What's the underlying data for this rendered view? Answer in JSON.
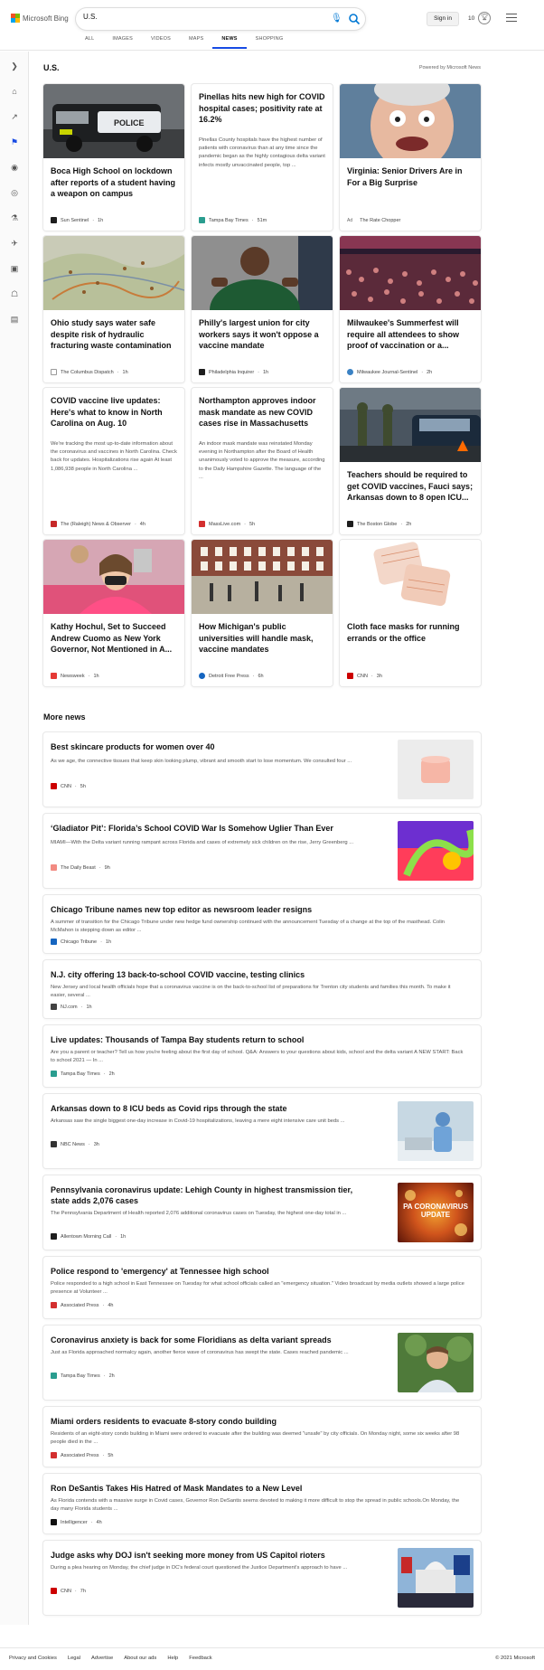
{
  "header": {
    "brand": "Microsoft Bing",
    "search_value": "U.S.",
    "sign_in": "Sign in",
    "rewards_count": "10",
    "tabs": [
      {
        "label": "ALL"
      },
      {
        "label": "IMAGES"
      },
      {
        "label": "VIDEOS"
      },
      {
        "label": "MAPS"
      },
      {
        "label": "NEWS"
      },
      {
        "label": "SHOPPING"
      }
    ],
    "active_tab": "NEWS",
    "accent": "#174ae4"
  },
  "rail": {
    "icons": [
      "expand-icon",
      "home-icon",
      "trending-icon",
      "flag-icon",
      "location-icon",
      "globe-icon",
      "science-icon",
      "rocket-icon",
      "video-icon",
      "building-icon",
      "grid-icon"
    ]
  },
  "section": {
    "title": "U.S.",
    "powered_by": "Powered by Microsoft News"
  },
  "cards": [
    {
      "headline": "Boca High School on lockdown after reports of a student having a weapon on campus",
      "source": "Sun Sentinel",
      "time": "1h",
      "image": "police-car",
      "fav": "#1e1e1e"
    },
    {
      "headline": "Pinellas hits new high for COVID hospital cases; positivity rate at 16.2%",
      "snippet": "Pinellas County hospitals have the highest number of patients with coronavirus than at any time since the pandemic began as the highly contagious delta variant infects mostly unvaccinated people, top ...",
      "source": "Tampa Bay Times",
      "time": "51m",
      "fav": "#2a9d8f"
    },
    {
      "headline": "Virginia: Senior Drivers Are in For a Big Surprise",
      "ad": "Ad",
      "source": "The Rate Chopper",
      "time": "",
      "image": "man-face",
      "fav": "#ffffff"
    },
    {
      "headline": "Ohio study says water safe despite risk of hydraulic fracturing waste contamination",
      "source": "The Columbus Dispatch",
      "time": "1h",
      "image": "map",
      "fav": "#ffffff"
    },
    {
      "headline": "Philly's largest union for city workers says it won't oppose a vaccine mandate",
      "source": "Philadelphia Inquirer",
      "time": "1h",
      "image": "man-green",
      "fav": "#1e1e1e"
    },
    {
      "headline": "Milwaukee's Summerfest will require all attendees to show proof of vaccination or a...",
      "source": "Milwaukee Journal-Sentinel",
      "time": "2h",
      "image": "crowd",
      "fav": "#3b82c4"
    },
    {
      "headline": "COVID vaccine live updates: Here's what to know in North Carolina on Aug. 10",
      "snippet": "We're tracking the most up-to-date information about the coronavirus and vaccines in North Carolina. Check back for updates. Hospitalizations rise again At least 1,086,938 people in North Carolina ...",
      "source": "The (Raleigh) News & Observer",
      "time": "4h",
      "fav": "#c62828"
    },
    {
      "headline": "Northampton approves indoor mask mandate as new COVID cases rise in Massachusetts",
      "snippet": "An indoor mask mandate was reinstated Monday evening in Northampton after the Board of Health unanimously voted to approve the measure, according to the Daily Hampshire Gazette. The language of the ...",
      "source": "MassLive.com",
      "time": "5h",
      "fav": "#d32f2f"
    },
    {
      "headline": "Teachers should be required to get COVID vaccines, Fauci says; Arkansas down to 8 open ICU...",
      "source": "The Boston Globe",
      "time": "2h",
      "image": "checkpoint",
      "fav": "#1e1e1e"
    },
    {
      "headline": "Kathy Hochul, Set to Succeed Andrew Cuomo as New York Governor, Not Mentioned in A...",
      "source": "Newsweek",
      "time": "1h",
      "image": "woman-mask",
      "fav": "#e53935"
    },
    {
      "headline": "How Michigan's public universities will handle mask, vaccine mandates",
      "source": "Detroit Free Press",
      "time": "6h",
      "image": "campus",
      "fav": "#1565c0"
    },
    {
      "headline": "Cloth face masks for running errands or the office",
      "source": "CNN",
      "time": "3h",
      "image": "masks",
      "fav": "#cc0000"
    }
  ],
  "more_news": {
    "title": "More news",
    "items": [
      {
        "headline": "Best skincare products for women over 40",
        "snippet": "As we age, the connective tissues that keep skin looking plump, vibrant and smooth start to lose momentum. We consulted four ...",
        "source": "CNN",
        "time": "5h",
        "image": "cream",
        "fav": "#cc0000"
      },
      {
        "headline": "‘Gladiator Pit’: Florida’s School COVID War Is Somehow Uglier Than Ever",
        "snippet": "MIAMI—With the Delta variant running rampant across Florida and cases of extremely sick children on the rise, Jerry Greenberg ...",
        "source": "The Daily Beast",
        "time": "9h",
        "image": "illustration",
        "fav": "#f28b82"
      },
      {
        "headline": "Chicago Tribune names new top editor as newsroom leader resigns",
        "snippet": "A summer of transition for the Chicago Tribune under new hedge fund ownership continued with the announcement Tuesday of a change at the top of the masthead. Colin McMahon is stepping down as editor ...",
        "source": "Chicago Tribune",
        "time": "1h",
        "fav": "#1565c0"
      },
      {
        "headline": "N.J. city offering 13 back-to-school COVID vaccine, testing clinics",
        "snippet": "New Jersey and local health officials hope that a coronavirus vaccine is on the back-to-school list of preparations for Trenton city students and families this month. To make it easier, several ...",
        "source": "NJ.com",
        "time": "1h",
        "fav": "#424242"
      },
      {
        "headline": "Live updates: Thousands of Tampa Bay students return to school",
        "snippet": "Are you a parent or teacher? Tell us how you're feeling about the first day of school. Q&A: Answers to your questions about kids, school and the delta variant A NEW START: Back to school 2021 — In ...",
        "source": "Tampa Bay Times",
        "time": "2h",
        "fav": "#2a9d8f"
      },
      {
        "headline": "Arkansas down to 8 ICU beds as Covid rips through the state",
        "snippet": "Arkansas saw the single biggest one-day increase in Covid-19 hospitalizations, leaving a mere eight intensive care unit beds ...",
        "source": "NBC News",
        "time": "3h",
        "image": "icu",
        "fav": "#333333"
      },
      {
        "headline": "Pennsylvania coronavirus update: Lehigh County in highest transmission tier, state adds 2,076 cases",
        "snippet": "The Pennsylvania Department of Health reported 2,076 additional coronavirus cases on Tuesday, the highest one-day total in ...",
        "source": "Allentown Morning Call",
        "time": "1h",
        "image": "virus",
        "image_text": "PA CORONAVIRUS UPDATE",
        "fav": "#1e1e1e"
      },
      {
        "headline": "Police respond to 'emergency' at Tennessee high school",
        "snippet": "Police responded to a high school in East Tennessee on Tuesday for what school officials called an \"emergency situation.\" Video broadcast by media outlets showed a large police presence at Volunteer ...",
        "source": "Associated Press",
        "time": "4h",
        "fav": "#d32f2f"
      },
      {
        "headline": "Coronavirus anxiety is back for some Floridians as delta variant spreads",
        "snippet": "Just as Florida approached normalcy again, another fierce wave of coronavirus has swept the state. Cases reached pandemic ...",
        "source": "Tampa Bay Times",
        "time": "2h",
        "image": "man-smile",
        "fav": "#2a9d8f"
      },
      {
        "headline": "Miami orders residents to evacuate 8-story condo building",
        "snippet": "Residents of an eight-story condo building in Miami were ordered to evacuate after the building was deemed \"unsafe\" by city officials. On Monday night, some six weeks after 98 people died in the ...",
        "source": "Associated Press",
        "time": "5h",
        "fav": "#d32f2f"
      },
      {
        "headline": "Ron DeSantis Takes His Hatred of Mask Mandates to a New Level",
        "snippet": "As Florida contends with a massive surge in Covid cases, Governor Ron DeSantis seems devoted to making it more difficult to stop the spread in public schools.On Monday, the day many Florida students ...",
        "source": "Intelligencer",
        "time": "4h",
        "fav": "#111111"
      },
      {
        "headline": "Judge asks why DOJ isn't seeking more money from US Capitol rioters",
        "snippet": "During a plea hearing on Monday, the chief judge in DC's federal court questioned the Justice Department's approach to have ...",
        "source": "CNN",
        "time": "7h",
        "image": "capitol",
        "fav": "#cc0000"
      }
    ]
  },
  "footer": {
    "links": [
      "Privacy and Cookies",
      "Legal",
      "Advertise",
      "About our ads",
      "Help",
      "Feedback"
    ],
    "copyright": "© 2021 Microsoft"
  }
}
